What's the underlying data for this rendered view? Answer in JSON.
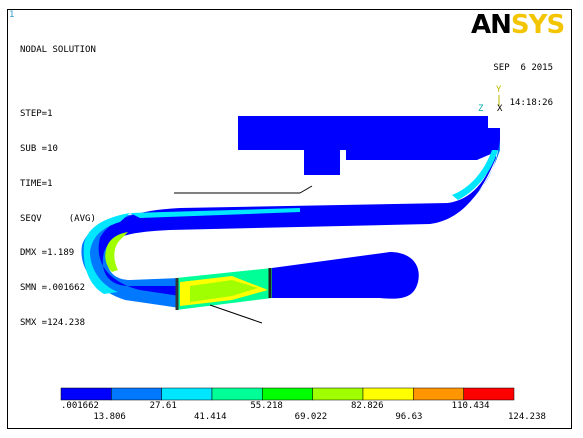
{
  "window_number": "1",
  "title": "NODAL SOLUTION",
  "info": {
    "step": "STEP=1",
    "sub": "SUB =10",
    "time": "TIME=1",
    "seqv": "SEQV     (AVG)",
    "dmx": "DMX =1.189",
    "smn": "SMN =.001662",
    "smx": "SMX =124.238"
  },
  "date": "SEP  6 2015",
  "clock": "14:18:26",
  "logo": {
    "an": "AN",
    "sys": "SYS"
  },
  "triad": {
    "y": "Y",
    "z": "Z",
    "x": "X"
  },
  "legend": {
    "colors": [
      "#0000ff",
      "#0078ff",
      "#00e6ff",
      "#00ff96",
      "#00ff00",
      "#a0ff00",
      "#ffff00",
      "#ff9600",
      "#ff0000"
    ],
    "ticks_top": [
      ".001662",
      "27.61",
      "55.218",
      "82.826",
      "110.434"
    ],
    "ticks_bottom": [
      "13.806",
      "41.414",
      "69.022",
      "96.63",
      "124.238"
    ]
  }
}
